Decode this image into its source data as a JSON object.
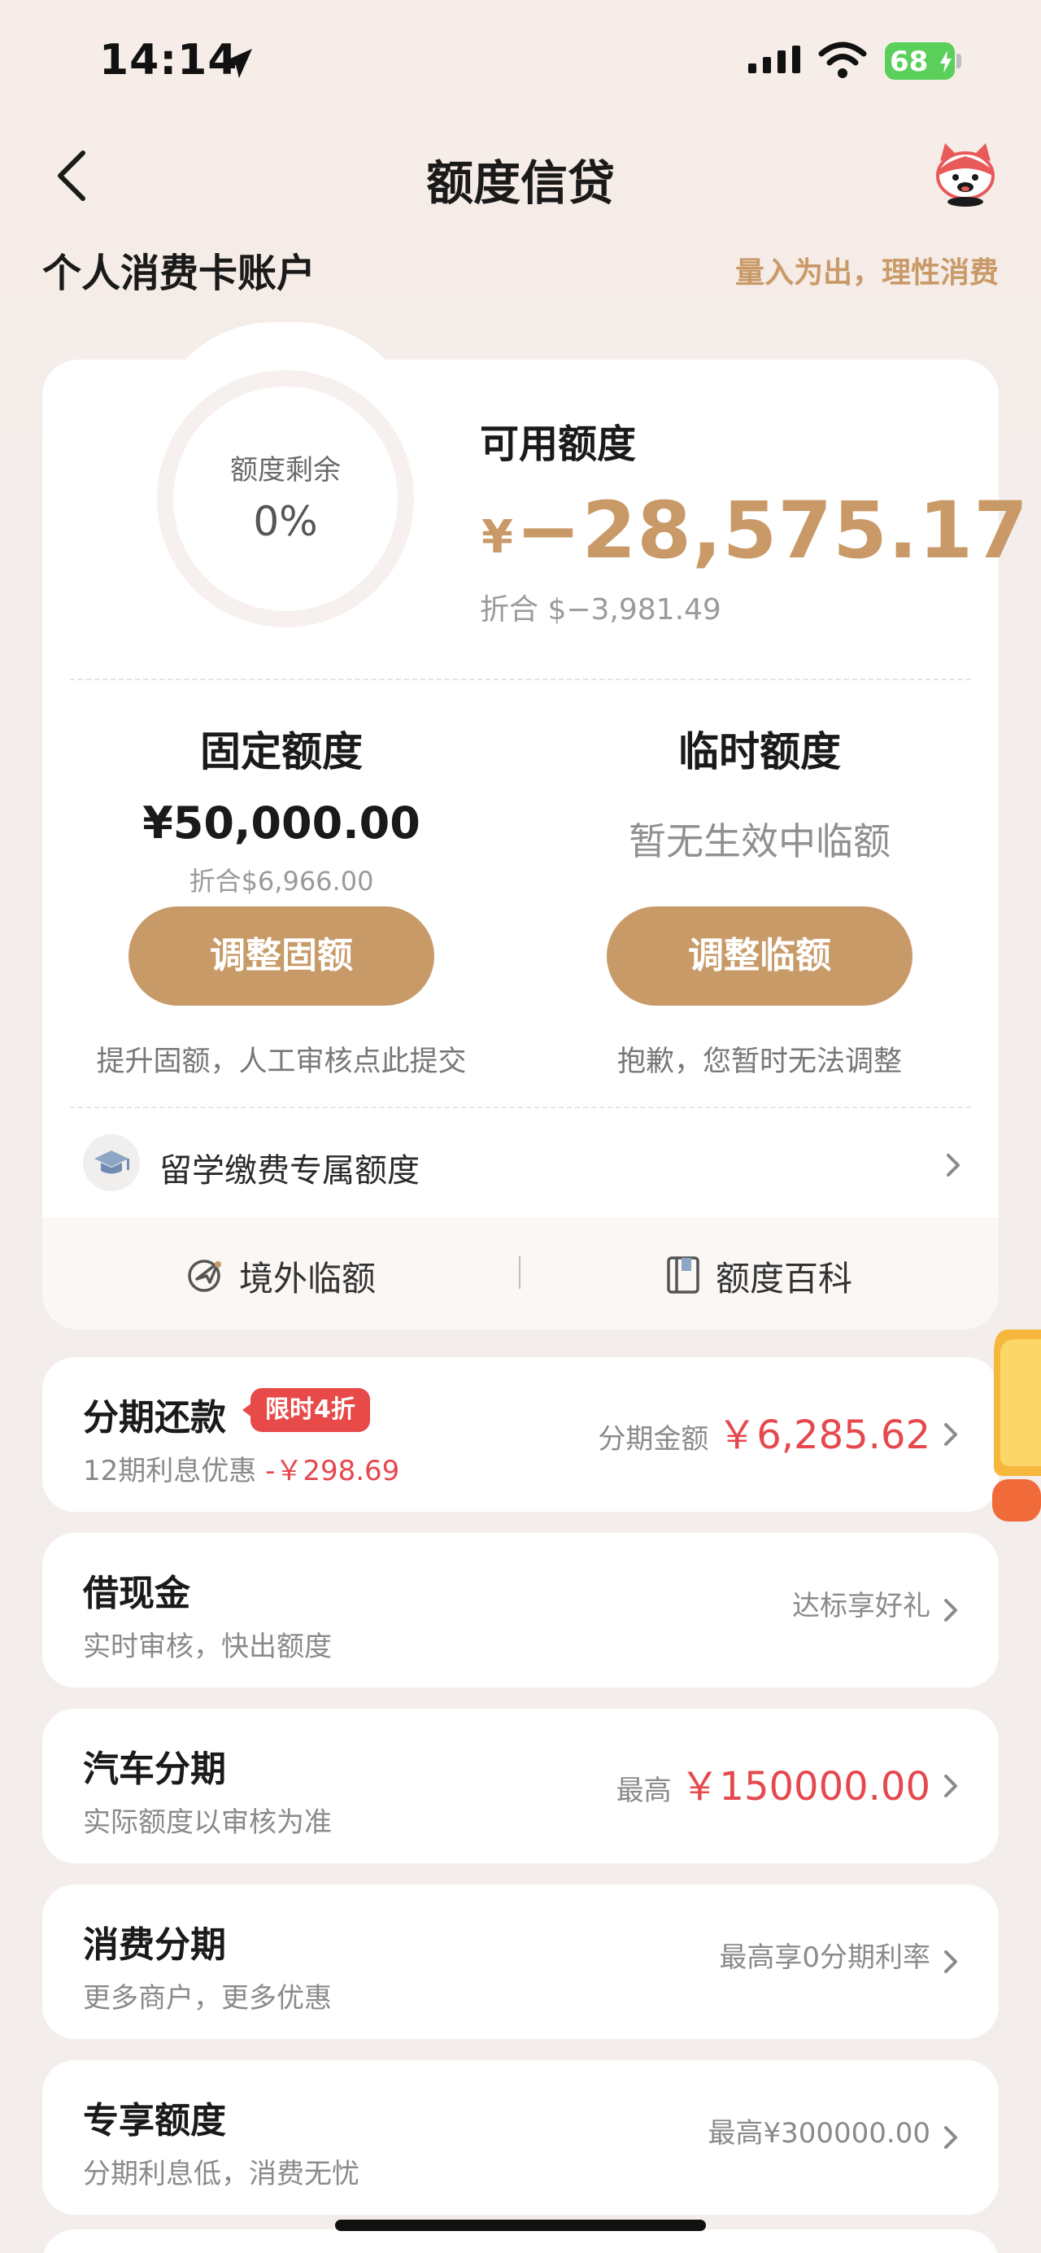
{
  "status_bar": {
    "time": "14:14",
    "battery": "68"
  },
  "header": {
    "title": "额度信贷"
  },
  "account": {
    "title": "个人消费卡账户",
    "slogan": "量入为出，理性消费"
  },
  "credit": {
    "ring_label": "额度剩余",
    "ring_value": "0%",
    "ring_fraction": 0.0,
    "available_label": "可用额度",
    "available_currency": "¥",
    "available_amount": "−28,575.17",
    "available_usd": "折合 $−3,981.49"
  },
  "fixed": {
    "title": "固定额度",
    "amount": "¥50,000.00",
    "usd": "折合$6,966.00",
    "button": "调整固额",
    "note": "提升固额，人工审核点此提交"
  },
  "temporary": {
    "title": "临时额度",
    "status": "暂无生效中临额",
    "button": "调整临额",
    "note": "抱歉，您暂时无法调整"
  },
  "study": {
    "label": "留学缴费专属额度"
  },
  "quick": {
    "overseas": "境外临额",
    "wiki": "额度百科"
  },
  "list": {
    "installment": {
      "title": "分期还款",
      "badge": "限时4折",
      "sub": "12期利息优惠",
      "sub_discount": "-￥298.69",
      "right_label": "分期金额",
      "right_value": "￥6,285.62"
    },
    "cash": {
      "title": "借现金",
      "sub": "实时审核，快出额度",
      "right": "达标享好礼"
    },
    "car": {
      "title": "汽车分期",
      "sub": "实际额度以审核为准",
      "right_label": "最高",
      "right_value": "￥150000.00"
    },
    "consume": {
      "title": "消费分期",
      "sub": "更多商户，更多优惠",
      "right": "最高享0分期利率"
    },
    "exclusive": {
      "title": "专享额度",
      "sub": "分期利息低，消费无忧",
      "right": "最高¥300000.00"
    }
  },
  "colors": {
    "accent": "#c89a68",
    "red": "#e5484d"
  }
}
